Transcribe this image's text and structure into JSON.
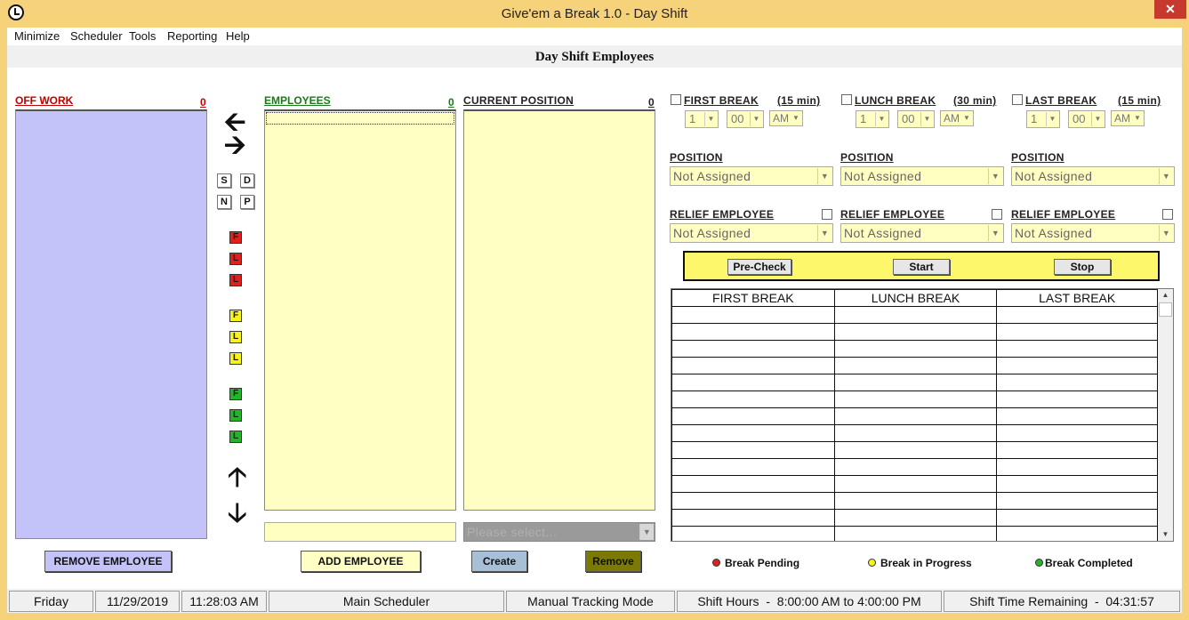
{
  "window": {
    "title": "Give'em a Break 1.0  - Day Shift",
    "close_label": "✕"
  },
  "menu": [
    "Minimize",
    "Scheduler",
    "Tools",
    "Reporting",
    "Help"
  ],
  "header": {
    "title": "Day Shift Employees"
  },
  "off_work": {
    "label": "OFF WORK",
    "count": "0"
  },
  "employees": {
    "label": "EMPLOYEES",
    "count": "0"
  },
  "current_position": {
    "label": "CURRENT POSITION",
    "count": "0",
    "select_placeholder": "Please select..."
  },
  "mid_buttons": {
    "s": "S",
    "d": "D",
    "n": "N",
    "p": "P",
    "f1": "F",
    "l1": "L",
    "l2": "L",
    "f2": "F",
    "l3": "L",
    "l4": "L",
    "f3": "F",
    "l5": "L",
    "l6": "L"
  },
  "breaks": [
    {
      "label": "FIRST BREAK",
      "duration": "(15 min)",
      "hour": "1",
      "minute": "00",
      "ampm": "AM",
      "position_label": "POSITION",
      "position_value": "Not Assigned",
      "relief_label": "RELIEF EMPLOYEE",
      "relief_value": "Not Assigned"
    },
    {
      "label": "LUNCH BREAK",
      "duration": "(30 min)",
      "hour": "1",
      "minute": "00",
      "ampm": "AM",
      "position_label": "POSITION",
      "position_value": "Not Assigned",
      "relief_label": "RELIEF EMPLOYEE",
      "relief_value": "Not Assigned"
    },
    {
      "label": "LAST BREAK",
      "duration": "(15 min)",
      "hour": "1",
      "minute": "00",
      "ampm": "AM",
      "position_label": "POSITION",
      "position_value": "Not Assigned",
      "relief_label": "RELIEF EMPLOYEE",
      "relief_value": "Not Assigned"
    }
  ],
  "controls": {
    "precheck": "Pre-Check",
    "start": "Start",
    "stop": "Stop"
  },
  "grid": {
    "headers": [
      "FIRST BREAK",
      "LUNCH BREAK",
      "LAST BREAK"
    ]
  },
  "buttons": {
    "remove_employee": "REMOVE EMPLOYEE",
    "add_employee": "ADD EMPLOYEE",
    "create": "Create",
    "remove": "Remove"
  },
  "legend": {
    "pending": "Break Pending",
    "progress": "Break in Progress",
    "completed": "Break Completed"
  },
  "status": {
    "day": "Friday",
    "date": "11/29/2019",
    "time": "11:28:03 AM",
    "screen": "Main Scheduler",
    "mode": "Manual Tracking Mode",
    "hours": "Shift Hours  -  8:00:00 AM to 4:00:00 PM",
    "remaining": "Shift Time Remaining  -  04:31:57"
  },
  "colors": {
    "accent_red": "#c00000",
    "accent_green": "#1a7a1a",
    "off_work_bg": "#c3c3fa",
    "list_bg": "#ffffc3",
    "remove_btn": "#7b7a04",
    "create_btn": "#a8bfd8"
  }
}
